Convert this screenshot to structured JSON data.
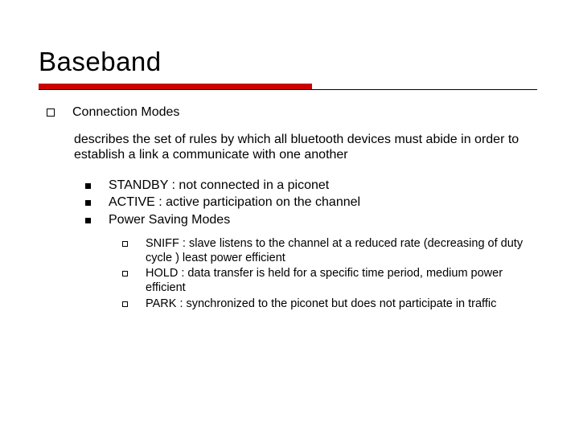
{
  "title": "Baseband",
  "section": {
    "heading": "Connection Modes",
    "description": "describes the set of rules by which all bluetooth devices must abide in order to establish a link a communicate with one another",
    "items": [
      {
        "text": "STANDBY : not connected in a piconet"
      },
      {
        "text": "ACTIVE : active participation on the channel"
      },
      {
        "text": "Power Saving Modes"
      }
    ],
    "subitems": [
      {
        "text": "SNIFF : slave listens to the channel at a reduced rate (decreasing of duty cycle ) least power efficient"
      },
      {
        "text": "HOLD : data transfer is held for a specific time period, medium power efficient"
      },
      {
        "text": "PARK : synchronized to the piconet but does not participate in traffic"
      }
    ]
  }
}
